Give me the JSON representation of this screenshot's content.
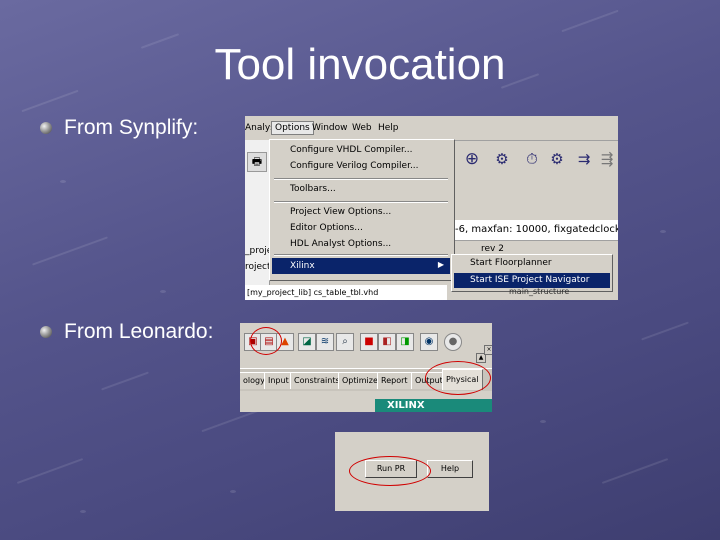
{
  "slide": {
    "title": "Tool invocation",
    "bullets": [
      {
        "text": "From Synplify:"
      },
      {
        "text": "From Leonardo:"
      }
    ]
  },
  "synplify": {
    "menubar": [
      "Analyst",
      "Options",
      "Window",
      "Web",
      "Help"
    ],
    "options_menu": {
      "items": [
        "Configure VHDL Compiler...",
        "Configure Verilog Compiler...",
        "Toolbars...",
        "Project View Options...",
        "Editor Options...",
        "HDL Analyst Options...",
        "Xilinx"
      ],
      "selected": "Xilinx"
    },
    "xilinx_submenu": {
      "items": [
        "Start Floorplanner",
        "Start ISE Project Navigator"
      ],
      "selected": "Start ISE Project Navigator"
    },
    "toolbar_icons": [
      "add-circle-icon",
      "gear-icon",
      "stopwatch-icon",
      "gear-small-icon",
      "filter-icon",
      "arrows-icon"
    ],
    "status_line": "-6,  maxfan: 10000,  fixgatedclock",
    "rev_label": "rev  2",
    "left_pane": [
      "_projec",
      "roject)"
    ],
    "file_line": "[my_project_lib] cs_table_tbl.vhd",
    "behind_item": "main_structure"
  },
  "leonardo": {
    "tabs": [
      "ology",
      "Input",
      "Constraints",
      "Optimize",
      "Report",
      "Output",
      "Physical"
    ],
    "active_tab": "Physical",
    "vendor_banner": "XILINX",
    "toolbar_icons": [
      "schematic-icon",
      "text-icon",
      "flow-icon",
      "tree-icon",
      "magnify-icon",
      "wave-icon",
      "chip-red-icon",
      "chip-green-icon",
      "globe-icon"
    ]
  },
  "physical_tab": {
    "run_pr": "Run PR",
    "help": "Help"
  },
  "colors": {
    "background": "#55558c",
    "menu_highlight": "#0a246a",
    "annotation": "#d00000",
    "xilinx_bar": "#1a8a7a"
  }
}
